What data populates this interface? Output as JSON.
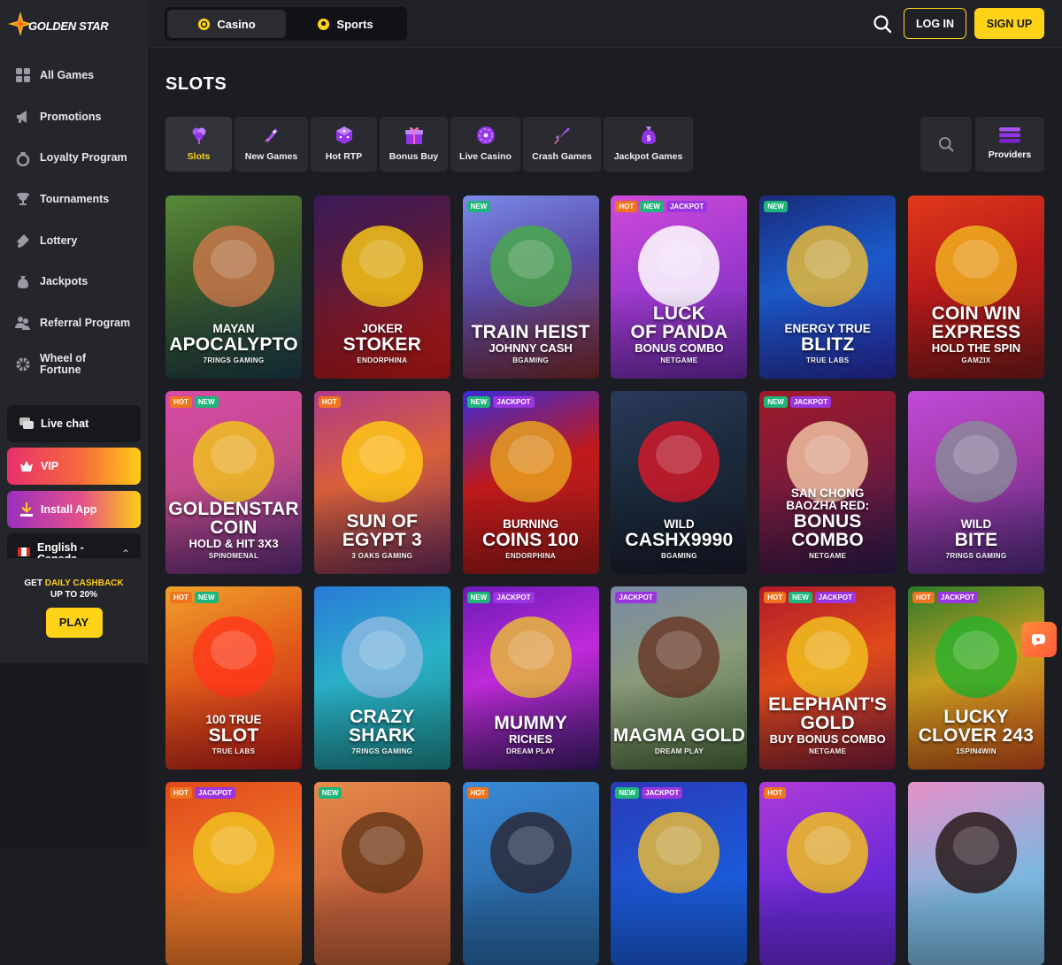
{
  "brand": {
    "name": "GOLDEN STAR"
  },
  "sidebar": {
    "items": [
      {
        "label": "All Games",
        "icon": "grid-icon"
      },
      {
        "label": "Promotions",
        "icon": "megaphone-icon"
      },
      {
        "label": "Loyalty Program",
        "icon": "ring-icon"
      },
      {
        "label": "Tournaments",
        "icon": "trophy-icon"
      },
      {
        "label": "Lottery",
        "icon": "ticket-icon"
      },
      {
        "label": "Jackpots",
        "icon": "money-bag-icon"
      },
      {
        "label": "Referral Program",
        "icon": "users-icon"
      },
      {
        "label": "Wheel of Fortune",
        "icon": "wheel-icon"
      }
    ],
    "live_chat": "Live chat",
    "vip": "VIP",
    "install": "Install App",
    "language": "English - Canada",
    "cashback": {
      "prefix": "GET",
      "highlight": "DAILY CASHBACK",
      "line2": "UP TO 20%",
      "button": "PLAY"
    }
  },
  "topbar": {
    "tabs": [
      {
        "label": "Casino",
        "active": true
      },
      {
        "label": "Sports",
        "active": false
      }
    ],
    "login": "LOG IN",
    "signup": "SIGN UP"
  },
  "page_title": "SLOTS",
  "categories": [
    {
      "label": "Slots",
      "active": true,
      "icon": "clover-icon"
    },
    {
      "label": "New Games",
      "icon": "rocket-icon"
    },
    {
      "label": "Hot RTP",
      "icon": "dice-icon"
    },
    {
      "label": "Bonus Buy",
      "icon": "gift-icon"
    },
    {
      "label": "Live Casino",
      "icon": "roulette-icon"
    },
    {
      "label": "Crash Games",
      "icon": "crash-rocket-icon"
    },
    {
      "label": "Jackpot Games",
      "icon": "coin-bag-icon"
    }
  ],
  "providers_label": "Providers",
  "colors": {
    "accent": "#ffd317",
    "hot": "#f0741f",
    "new": "#1fb57a",
    "jackpot": "#9a35e0"
  },
  "games": [
    {
      "a": "MAYAN",
      "b": "APOCALYPTO",
      "c": "",
      "provider": "7RINGS GAMING",
      "badges": []
    },
    {
      "a": "JOKER",
      "b": "STOKER",
      "c": "",
      "provider": "ENDORPHINA",
      "badges": []
    },
    {
      "a": "",
      "b": "TRAIN HEIST",
      "c": "JOHNNY CASH",
      "provider": "BGAMING",
      "badges": [
        "NEW"
      ]
    },
    {
      "a": "",
      "b": "LUCK\nOF PANDA",
      "c": "BONUS COMBO",
      "provider": "NETGAME",
      "badges": [
        "HOT",
        "NEW",
        "JACKPOT"
      ]
    },
    {
      "a": "ENERGY TRUE",
      "b": "BLITZ",
      "c": "",
      "provider": "TRUE LABS",
      "badges": [
        "NEW"
      ]
    },
    {
      "a": "",
      "b": "COIN WIN\nEXPRESS",
      "c": "HOLD THE SPIN",
      "provider": "GAMZIX",
      "badges": []
    },
    {
      "a": "",
      "b": "GOLDENSTAR\nCOIN",
      "c": "HOLD & HIT 3X3",
      "provider": "SPINOMENAL",
      "badges": [
        "HOT",
        "NEW"
      ]
    },
    {
      "a": "",
      "b": "SUN OF\nEGYPT 3",
      "c": "",
      "provider": "3 OAKS GAMING",
      "badges": [
        "HOT"
      ]
    },
    {
      "a": "BURNING",
      "b": "COINS 100",
      "c": "",
      "provider": "ENDORPHINA",
      "badges": [
        "NEW",
        "JACKPOT"
      ]
    },
    {
      "a": "WILD",
      "b": "CASHX9990",
      "c": "",
      "provider": "BGAMING",
      "badges": []
    },
    {
      "a": "SAN CHONG\nBAOZHA RED:",
      "b": "BONUS COMBO",
      "c": "",
      "provider": "NETGAME",
      "badges": [
        "NEW",
        "JACKPOT"
      ]
    },
    {
      "a": "WILD",
      "b": "BITE",
      "c": "",
      "provider": "7RINGS GAMING",
      "badges": []
    },
    {
      "a": "100 TRUE",
      "b": "SLOT",
      "c": "",
      "provider": "TRUE LABS",
      "badges": [
        "HOT",
        "NEW"
      ]
    },
    {
      "a": "",
      "b": "CRAZY\nSHARK",
      "c": "",
      "provider": "7RINGS GAMING",
      "badges": []
    },
    {
      "a": "",
      "b": "MUMMY",
      "c": "RICHES",
      "provider": "DREAM PLAY",
      "badges": [
        "NEW",
        "JACKPOT"
      ]
    },
    {
      "a": "",
      "b": "MAGMA GOLD",
      "c": "",
      "provider": "DREAM PLAY",
      "badges": [
        "JACKPOT"
      ]
    },
    {
      "a": "",
      "b": "ELEPHANT'S\nGOLD",
      "c": "BUY BONUS COMBO",
      "provider": "NETGAME",
      "badges": [
        "HOT",
        "NEW",
        "JACKPOT"
      ]
    },
    {
      "a": "",
      "b": "LUCKY\nCLOVER 243",
      "c": "",
      "provider": "1SPIN4WIN",
      "badges": [
        "HOT",
        "JACKPOT"
      ]
    },
    {
      "a": "",
      "b": "",
      "c": "",
      "provider": "",
      "badges": [
        "HOT",
        "JACKPOT"
      ]
    },
    {
      "a": "",
      "b": "",
      "c": "",
      "provider": "",
      "badges": [
        "NEW"
      ]
    },
    {
      "a": "",
      "b": "",
      "c": "",
      "provider": "",
      "badges": [
        "HOT"
      ]
    },
    {
      "a": "",
      "b": "",
      "c": "",
      "provider": "",
      "badges": [
        "NEW",
        "JACKPOT"
      ]
    },
    {
      "a": "",
      "b": "",
      "c": "",
      "provider": "",
      "badges": [
        "HOT"
      ]
    },
    {
      "a": "",
      "b": "",
      "c": "",
      "provider": "",
      "badges": []
    }
  ]
}
